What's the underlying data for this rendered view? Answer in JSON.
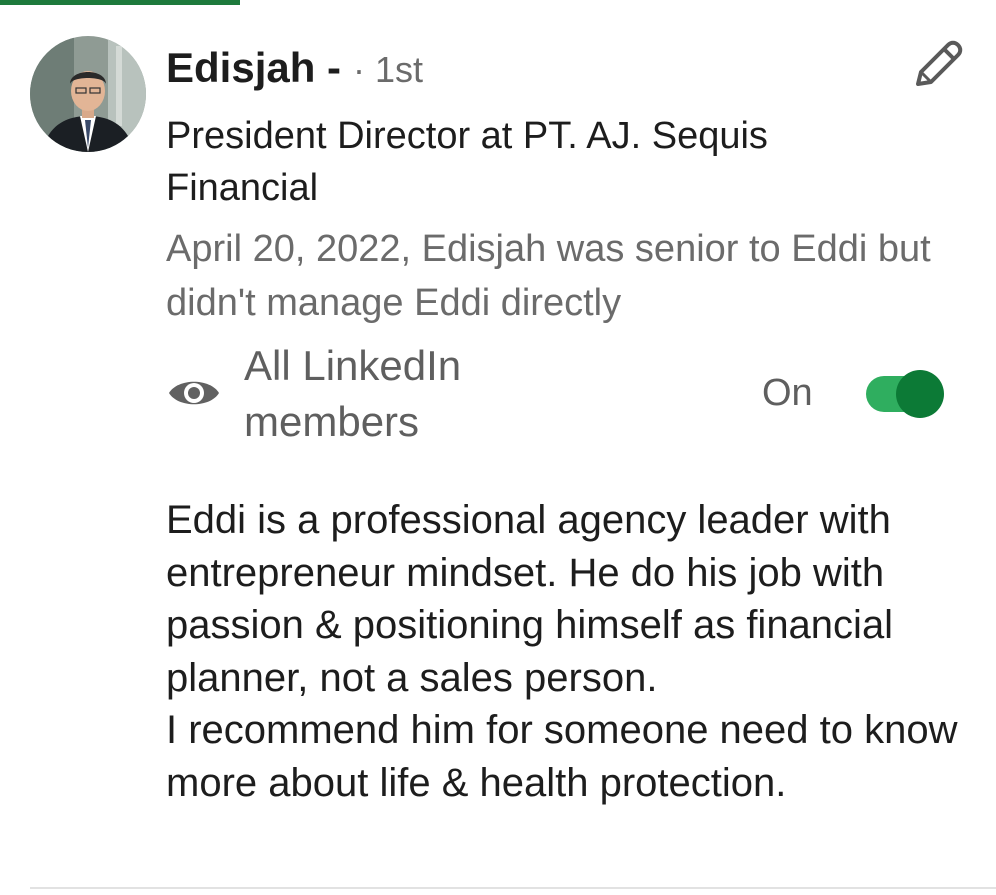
{
  "recommendation": {
    "name": "Edisjah -",
    "degree": "· 1st",
    "headline": "President Director at PT. AJ. Sequis Financial",
    "relationship": "April 20, 2022, Edisjah was senior to Eddi but didn't manage Eddi directly",
    "visibility": {
      "icon": "eye-icon",
      "label": "All LinkedIn members",
      "toggle_state": "On",
      "toggle_on": true
    },
    "body_paragraphs": [
      "Eddi is a professional agency leader with entrepreneur mindset. He do his job with passion & positioning himself as financial planner, not a sales person.",
      "I recommend him for someone need to know more about life & health protection."
    ],
    "edit_icon": "pencil-icon"
  },
  "colors": {
    "accent": "#1e7a3c",
    "toggle_track": "#2fae5f",
    "toggle_knob": "#0c7a36",
    "secondary_text": "#6b6b6b"
  }
}
